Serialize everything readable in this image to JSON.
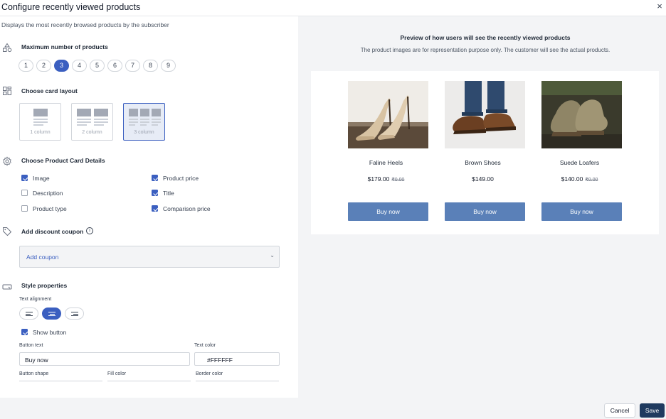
{
  "header": {
    "title": "Configure recently viewed products",
    "close_icon": "×"
  },
  "subtitle": "Displays the most recently browsed products by the subscriber",
  "max_products": {
    "label": "Maximum number of products",
    "options": [
      "1",
      "2",
      "3",
      "4",
      "5",
      "6",
      "7",
      "8",
      "9"
    ],
    "selected": "3"
  },
  "card_layout": {
    "label": "Choose card layout",
    "options": [
      "1 column",
      "2 column",
      "3 column"
    ],
    "selected": "3 column"
  },
  "card_details": {
    "label": "Choose Product Card Details",
    "items": [
      {
        "label": "Image",
        "checked": true
      },
      {
        "label": "Product price",
        "checked": true
      },
      {
        "label": "Description",
        "checked": false
      },
      {
        "label": "Title",
        "checked": true
      },
      {
        "label": "Product type",
        "checked": false
      },
      {
        "label": "Comparison price",
        "checked": true
      }
    ]
  },
  "discount": {
    "label": "Add discount coupon",
    "info_icon": "i",
    "dropdown_text": "Add coupon",
    "chevron": "⌄"
  },
  "style": {
    "label": "Style properties",
    "text_alignment_label": "Text alignment",
    "alignment_options": [
      "left",
      "center",
      "right"
    ],
    "alignment_selected": "center",
    "show_button": {
      "label": "Show button",
      "checked": true
    },
    "button_text_label": "Button text",
    "button_text_value": "Buy now",
    "text_color_label": "Text color",
    "text_color_value": "#FFFFFF",
    "button_shape_label": "Button shape",
    "fill_color_label": "Fill color",
    "border_color_label": "Border color"
  },
  "preview": {
    "title": "Preview of how users will see the recently viewed products",
    "subtitle": "The product images are for representation purpose only. The customer will see the actual products.",
    "products": [
      {
        "name": "Faline Heels",
        "price": "$179.00",
        "compare_price": "₹0.00",
        "button": "Buy now"
      },
      {
        "name": "Brown Shoes",
        "price": "$149.00",
        "compare_price": "",
        "button": "Buy now"
      },
      {
        "name": "Suede Loafers",
        "price": "$140.00",
        "compare_price": "₹0.00",
        "button": "Buy now"
      }
    ]
  },
  "footer": {
    "cancel": "Cancel",
    "save": "Save"
  },
  "colors": {
    "accent": "#3b5fc0",
    "buy_button": "#5a80b8",
    "save_button": "#1f3a5f"
  }
}
